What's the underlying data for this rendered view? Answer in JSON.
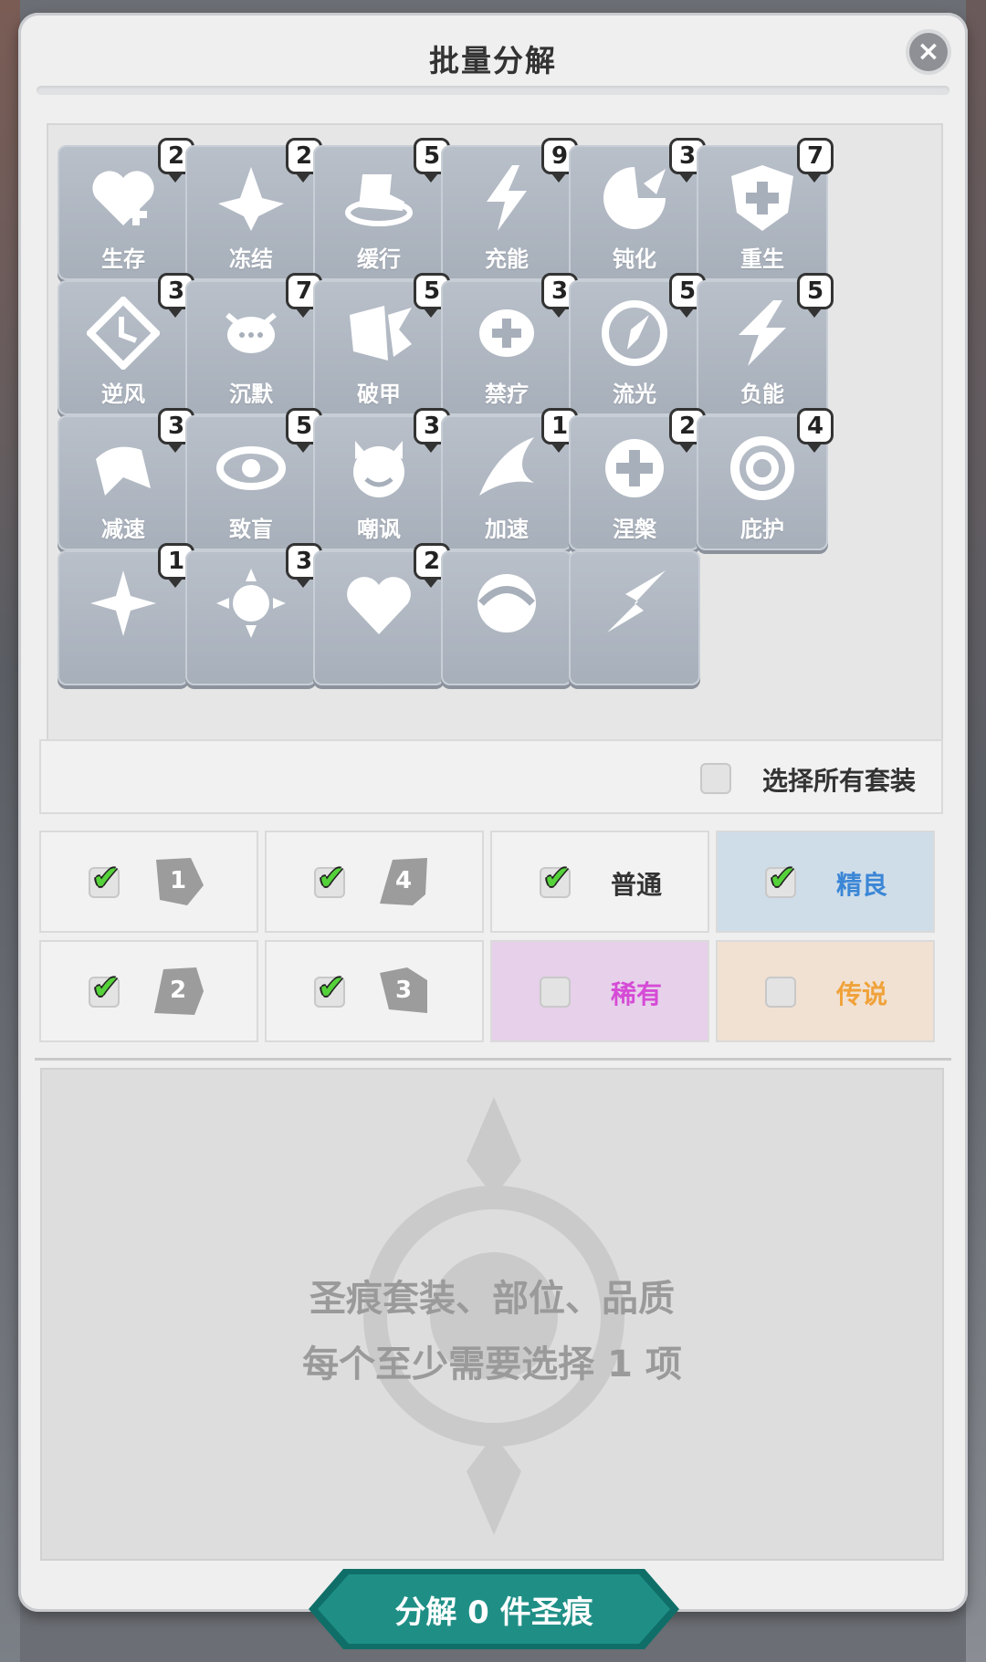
{
  "dialog": {
    "title": "批量分解",
    "close_icon": "close-icon"
  },
  "sets": [
    {
      "name": "生存",
      "count": "2",
      "icon": "heart-plus-icon"
    },
    {
      "name": "冻结",
      "count": "2",
      "icon": "ice-crystal-icon"
    },
    {
      "name": "缓行",
      "count": "5",
      "icon": "boot-icon"
    },
    {
      "name": "充能",
      "count": "9",
      "icon": "lightning-icon"
    },
    {
      "name": "钝化",
      "count": "3",
      "icon": "broken-shield-icon"
    },
    {
      "name": "重生",
      "count": "7",
      "icon": "cross-shield-icon"
    },
    {
      "name": "逆风",
      "count": "3",
      "icon": "clock-diamond-icon"
    },
    {
      "name": "沉默",
      "count": "7",
      "icon": "silence-bubble-icon"
    },
    {
      "name": "破甲",
      "count": "5",
      "icon": "armor-break-icon"
    },
    {
      "name": "禁疗",
      "count": "3",
      "icon": "no-heal-icon"
    },
    {
      "name": "流光",
      "count": "5",
      "icon": "compass-icon"
    },
    {
      "name": "负能",
      "count": "5",
      "icon": "negative-bolt-icon"
    },
    {
      "name": "减速",
      "count": "3",
      "icon": "slow-icon"
    },
    {
      "name": "致盲",
      "count": "5",
      "icon": "eye-icon"
    },
    {
      "name": "嘲讽",
      "count": "3",
      "icon": "devil-face-icon"
    },
    {
      "name": "加速",
      "count": "1",
      "icon": "wing-icon"
    },
    {
      "name": "涅槃",
      "count": "2",
      "icon": "phoenix-cross-icon"
    },
    {
      "name": "庇护",
      "count": "4",
      "icon": "ring-icon"
    },
    {
      "name": "",
      "count": "1",
      "icon": "star-diamond-icon"
    },
    {
      "name": "",
      "count": "3",
      "icon": "sun-gear-icon"
    },
    {
      "name": "",
      "count": "2",
      "icon": "fang-heart-icon"
    },
    {
      "name": "",
      "count": "",
      "icon": "swirl-icon"
    },
    {
      "name": "",
      "count": "",
      "icon": "arrow-burst-icon"
    }
  ],
  "select_all": {
    "label": "选择所有套装",
    "checked": false
  },
  "positions": [
    {
      "label": "1",
      "checked": true
    },
    {
      "label": "4",
      "checked": true
    },
    {
      "label": "2",
      "checked": true
    },
    {
      "label": "3",
      "checked": true
    }
  ],
  "qualities": [
    {
      "label": "普通",
      "checked": true,
      "color": "#333333",
      "bg": "#f2f2f2"
    },
    {
      "label": "精良",
      "checked": true,
      "color": "#3b86d6",
      "bg": "#cfdde9"
    },
    {
      "label": "稀有",
      "checked": false,
      "color": "#d64bd6",
      "bg": "#e6d0ea"
    },
    {
      "label": "传说",
      "checked": false,
      "color": "#f0a23a",
      "bg": "#f1e1d2"
    }
  ],
  "info": {
    "line1": "圣痕套装、部位、品质",
    "line2": "每个至少需要选择 1 项"
  },
  "action": {
    "label": "分解 0 件圣痕",
    "color": "#1f8f86"
  }
}
